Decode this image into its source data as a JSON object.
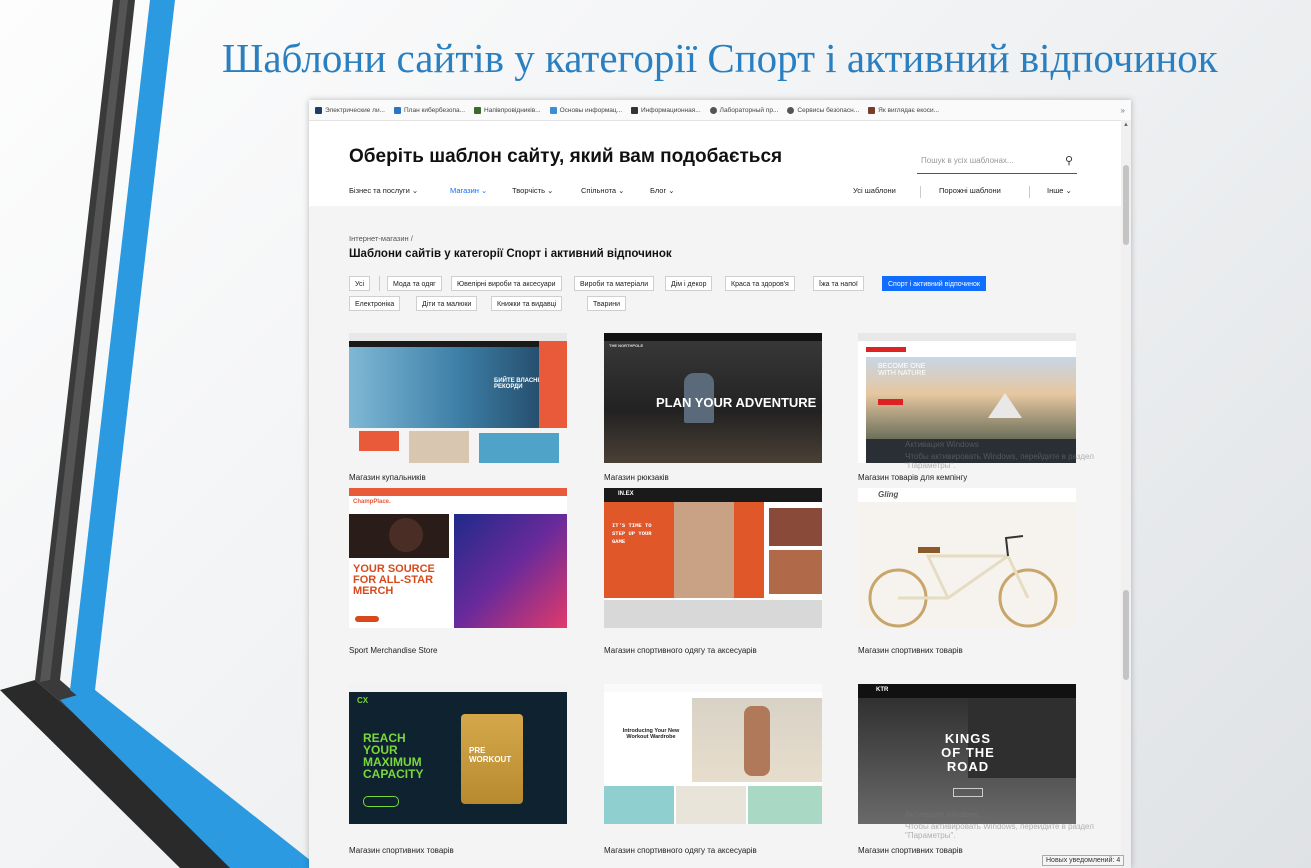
{
  "slide": {
    "title": "Шаблони сайтів у категорії Спорт і активний відпочинок"
  },
  "bookmarks": [
    {
      "label": "Электрические ли...",
      "color": "#1d3d6b"
    },
    {
      "label": "План кибербезопа...",
      "color": "#2a76c6"
    },
    {
      "label": "Напівпровідників...",
      "color": "#3a6a2c"
    },
    {
      "label": "Основы информац...",
      "color": "#3a8ed8"
    },
    {
      "label": "Информационная...",
      "color": "#333333"
    },
    {
      "label": "Лабораторный пр...",
      "color": "#555555"
    },
    {
      "label": "Сервисы безопасн...",
      "color": "#555555"
    },
    {
      "label": "Як виглядає екоси...",
      "color": "#7a3b2a"
    }
  ],
  "bookmarks_more": "»",
  "header": {
    "title": "Оберіть шаблон сайту, який вам подобається",
    "search_placeholder": "Пошук в усіх шаблонах...",
    "search_icon": "search-icon"
  },
  "nav": {
    "items": [
      "Бізнес та послуги ⌄",
      "Магазин ⌄",
      "Творчість ⌄",
      "Спільнота ⌄",
      "Блог ⌄"
    ],
    "right": [
      "Усі шаблони",
      "Порожні шаблони",
      "Інше ⌄"
    ]
  },
  "breadcrumb": "Інтернет-магазин /",
  "category_title": "Шаблони сайтів у категорії Спорт і активний відпочинок",
  "chips": {
    "all": "Усі",
    "row1": [
      "Мода та одяг",
      "Ювелірні вироби та аксесуари",
      "Вироби та матеріали",
      "Дім і декор",
      "Краса та здоров'я",
      "Їжа та напої",
      "Спорт і активний відпочинок"
    ],
    "row2": [
      "Електроніка",
      "Діти та малюки",
      "Книжки та видавці",
      "Тварини"
    ],
    "active": "Спорт і активний відпочинок"
  },
  "cards": [
    {
      "label": "Магазин купальників",
      "thumb_text": "БИЙТЕ ВЛАСНІ РЕКОРДИ"
    },
    {
      "label": "Магазин рюкзаків",
      "thumb_text": "PLAN YOUR ADVENTURE",
      "brand": "THE NORTHPOLE"
    },
    {
      "label": "Магазин товарів для кемпінгу",
      "thumb_text": "BECOME ONE WITH NATURE"
    },
    {
      "label": "Sport Merchandise Store",
      "thumb_text": "YOUR SOURCE FOR ALL-STAR MERCH",
      "brand": "ChampPlace."
    },
    {
      "label": "Магазин спортивного одягу та аксесуарів",
      "thumb_text": "IT'S TIME TO STEP UP YOUR GAME",
      "brand": "IN.EX"
    },
    {
      "label": "Магазин спортивних товарів",
      "brand": "Gling"
    },
    {
      "label": "Магазин спортивних товарів",
      "thumb_text": "REACH YOUR MAXIMUM CAPACITY",
      "brand": "CX",
      "badge": "PRE WORKOUT"
    },
    {
      "label": "Магазин спортивного одягу та аксесуарів",
      "thumb_text": "Introducing Your New Workout Wardrobe"
    },
    {
      "label": "Магазин спортивних товарів",
      "thumb_text": "KINGS OF THE ROAD",
      "brand": "KTR"
    }
  ],
  "activation": {
    "line1": "Активация Windows",
    "line2": "Чтобы активировать Windows, перейдите в раздел \"Параметры\"."
  },
  "notification": "Новых уведомлений: 4"
}
